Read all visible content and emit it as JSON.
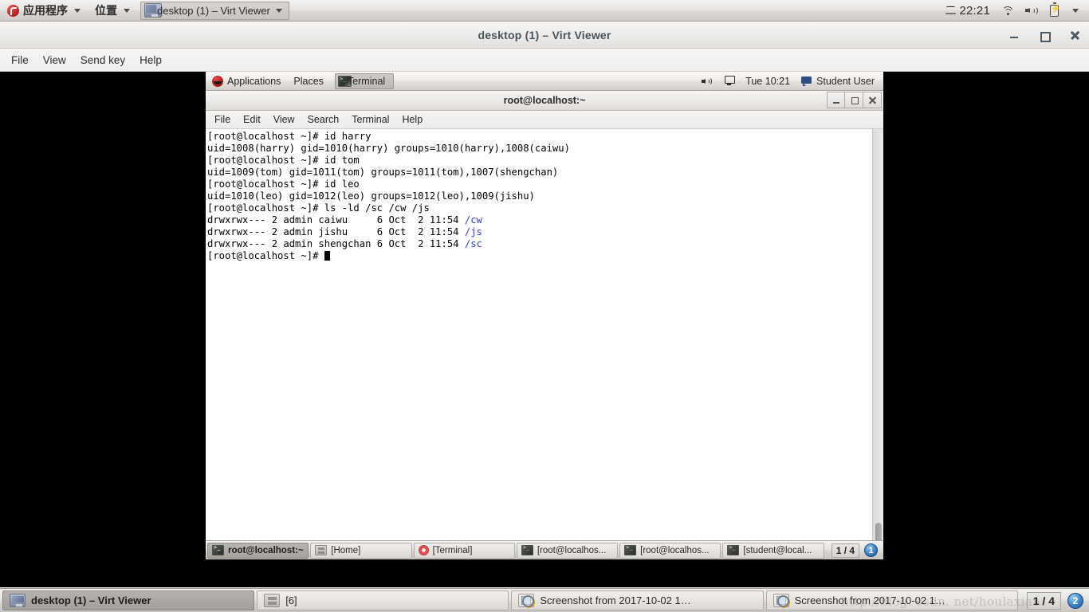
{
  "host_panel": {
    "applications_label": "应用程序",
    "places_label": "位置",
    "window_button_label": "desktop (1) – Virt Viewer",
    "day_char": "二",
    "clock": "22:21",
    "icons": [
      "wifi-icon",
      "volume-icon",
      "battery-icon",
      "chevron-down-icon"
    ]
  },
  "virt_viewer": {
    "title": "desktop (1) – Virt Viewer",
    "menus": [
      "File",
      "View",
      "Send key",
      "Help"
    ],
    "window_controls": [
      "minimize",
      "maximize",
      "close"
    ]
  },
  "guest_panel": {
    "applications_label": "Applications",
    "places_label": "Places",
    "window_button_label": "Terminal",
    "clock": "Tue 10:21",
    "user": "Student User"
  },
  "terminal": {
    "title": "root@localhost:~",
    "menus": [
      "File",
      "Edit",
      "View",
      "Search",
      "Terminal",
      "Help"
    ],
    "window_controls": [
      "minimize",
      "maximize",
      "close"
    ],
    "lines": [
      [
        {
          "t": "[root@localhost ~]# id harry"
        }
      ],
      [
        {
          "t": "uid=1008(harry) gid=1010(harry) groups=1010(harry),1008(caiwu)"
        }
      ],
      [
        {
          "t": "[root@localhost ~]# id tom"
        }
      ],
      [
        {
          "t": "uid=1009(tom) gid=1011(tom) groups=1011(tom),1007(shengchan)"
        }
      ],
      [
        {
          "t": "[root@localhost ~]# id leo"
        }
      ],
      [
        {
          "t": "uid=1010(leo) gid=1012(leo) groups=1012(leo),1009(jishu)"
        }
      ],
      [
        {
          "t": "[root@localhost ~]# ls -ld /sc /cw /js"
        }
      ],
      [
        {
          "t": "drwxrwx--- 2 admin caiwu     6 Oct  2 11:54 "
        },
        {
          "t": "/cw",
          "c": "b"
        }
      ],
      [
        {
          "t": "drwxrwx--- 2 admin jishu     6 Oct  2 11:54 "
        },
        {
          "t": "/js",
          "c": "b"
        }
      ],
      [
        {
          "t": "drwxrwx--- 2 admin shengchan 6 Oct  2 11:54 "
        },
        {
          "t": "/sc",
          "c": "b"
        }
      ],
      [
        {
          "t": "[root@localhost ~]# "
        },
        {
          "t": "",
          "c": "cursor"
        }
      ]
    ],
    "colors": {
      "foreground": "#000000",
      "background": "#ffffff",
      "directory": "#2f44d6"
    }
  },
  "guest_taskbar": {
    "tasks": [
      {
        "label": "root@localhost:~",
        "icon": "terminal-icon",
        "active": true
      },
      {
        "label": "[Home]",
        "icon": "files-icon",
        "active": false
      },
      {
        "label": "[Terminal]",
        "icon": "help-icon",
        "active": false
      },
      {
        "label": "[root@localhos...",
        "icon": "terminal-icon",
        "active": false
      },
      {
        "label": "[root@localhos...",
        "icon": "terminal-icon",
        "active": false
      },
      {
        "label": "[student@local...",
        "icon": "terminal-icon",
        "active": false
      }
    ],
    "pager": "1 / 4",
    "badge": "1"
  },
  "host_taskbar": {
    "tasks": [
      {
        "label": "desktop (1) – Virt Viewer",
        "icon": "monitor-icon",
        "active": true
      },
      {
        "label": "[6]",
        "icon": "files-icon",
        "active": false
      },
      {
        "label": "Screenshot from 2017-10-02 1…",
        "icon": "screenshot-icon",
        "active": false
      },
      {
        "label": "Screenshot from 2017-10-02 1…",
        "icon": "screenshot-icon",
        "active": false
      }
    ],
    "pager": "1 / 4",
    "badge": "2"
  },
  "watermark": "http://blog. csdn. net/houlaxian"
}
